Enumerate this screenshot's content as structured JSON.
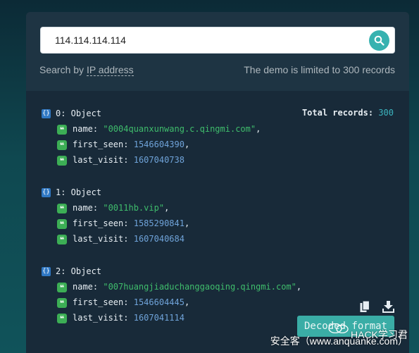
{
  "search": {
    "value": "114.114.114.114",
    "hint_prefix": "Search by ",
    "hint_link": "IP address",
    "limit_note": "The demo is limited to 300 records"
  },
  "results": {
    "total_label": "Total records: ",
    "total_value": "300",
    "records": [
      {
        "header": "0: Object",
        "name_key": "name:",
        "name_value": "\"0004quanxunwang.c.qingmi.com\"",
        "first_seen_key": "first_seen:",
        "first_seen_value": "1546604390",
        "last_visit_key": "last_visit:",
        "last_visit_value": "1607040738"
      },
      {
        "header": "1: Object",
        "name_key": "name:",
        "name_value": "\"0011hb.vip\"",
        "first_seen_key": "first_seen:",
        "first_seen_value": "1585290841",
        "last_visit_key": "last_visit:",
        "last_visit_value": "1607040684"
      },
      {
        "header": "2: Object",
        "name_key": "name:",
        "name_value": "\"007huangjiaduchanggaoqing.qingmi.com\"",
        "first_seen_key": "first_seen:",
        "first_seen_value": "1546604445",
        "last_visit_key": "last_visit:",
        "last_visit_value": "1607041114"
      }
    ]
  },
  "actions": {
    "decode_label": "Decoded format"
  },
  "watermark": {
    "line1": "HACK学习君",
    "line2": "安全客（www.anquanke.com）"
  },
  "icons": {
    "search": "search-icon",
    "copy": "copy-icon",
    "download": "download-icon",
    "object": "object-braces-icon",
    "quote": "quote-icon",
    "wechat": "wechat-icon"
  },
  "colors": {
    "accent": "#37b2b0",
    "string": "#3fbd6c",
    "number": "#6fa3d9",
    "panel": "#182a39"
  }
}
